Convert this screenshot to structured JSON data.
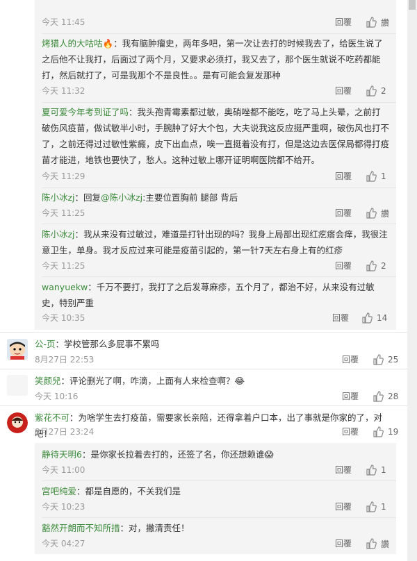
{
  "replies_block": [
    {
      "user": "",
      "text": "",
      "time": "今天 11:45",
      "reply_label": "回覆",
      "likes": "讚"
    },
    {
      "user": "烤猎人的大咕咕",
      "sep": "：",
      "text": "我有脑肿瘤史，两年多吧，第一次让去打的时候我去了，给医生说了之后他不让我打，后面过了两个月，又要求必须打，我又去了，那个医生就说不吃药都能打，然后就打了，可是我那个不是良性。。是有可能会复发那种",
      "time": "今天 11:32",
      "reply_label": "回覆",
      "likes": "2"
    },
    {
      "user": "夏可爱今年考到证了吗",
      "sep": "：",
      "text": "我头孢青霉素都过敏，奥硝唑都不能吃，吃了马上头晕，之前打破伤风疫苗，做试敏半小时，手腕肿了好大个包，大夫说我这反应挺严重啊，破伤风也打不了，之前还得过过敏性紫癜，皮下出血点，唉一直挺着没有打，但是这边去医保局都得打疫苗才能进，地铁也要快了，愁人。这种过敏上哪开证明啊医院都不给开。",
      "time": "今天 11:29",
      "reply_label": "回覆",
      "likes": "1"
    },
    {
      "user": "陈小冰zj",
      "sep": "：回复",
      "mention": "@陈小冰zj",
      "text": ":主要位置胸前 腿部 背后",
      "time": "今天 11:25",
      "reply_label": "回覆",
      "likes": "讚"
    },
    {
      "user": "陈小冰zj",
      "sep": "：",
      "text": "我从来没有过敏过，难道是打针出现的吗？我身上局部出现红疙瘩会痒，我很注意卫生，单身。我才反应过来可能是疫苗引起的，第一针7天左右身上有的红疹",
      "time": "今天 11:25",
      "reply_label": "回覆",
      "likes": "2"
    },
    {
      "user": "wanyuekw",
      "sep": "：",
      "text": "千万不要打，我打了之后发荨麻疹，五个月了，都治不好，从来没有过敏史，特别严重",
      "time": "今天 10:35",
      "reply_label": "回覆",
      "likes": "14"
    }
  ],
  "top_comments": [
    {
      "user": "公-页",
      "text": "学校管那么多屁事不累吗",
      "time": "8月27日 22:53",
      "reply_label": "回覆",
      "likes": "25",
      "avatar": "crayon-avatar"
    },
    {
      "user": "笑颜兒",
      "text": "评论删光了啊，咋滴，上面有人来检查啊？",
      "emoji": "😂",
      "time": "今天 10:16",
      "reply_label": "回覆",
      "likes": "28",
      "avatar": "blank-avatar"
    },
    {
      "user": "紫花不可",
      "text": "为啥学生去打疫苗，需要家长亲陪，还得拿着户口本，出了事就是你家的了，对吧！",
      "time": "8月27日 23:24",
      "reply_label": "回覆",
      "likes": "19",
      "avatar": "red-avatar"
    }
  ],
  "sub_replies": [
    {
      "user": "静待天明6",
      "sep": "：",
      "text": "是你家长拉着去打的，还签了名，你还想赖谁",
      "emoji": "😱",
      "time": "今天 11:00",
      "reply_label": "回覆",
      "likes": "1"
    },
    {
      "user": "宫吧纯爱",
      "sep": "：",
      "text": "都是自愿的，不关我们是",
      "time": "今天 10:23",
      "reply_label": "回覆",
      "likes": "1"
    },
    {
      "user": "豁然开朗而不知所措",
      "sep": "：",
      "text": "对，撇清责任！",
      "time": "今天 04:27",
      "reply_label": "回覆",
      "likes": "讚"
    }
  ],
  "colors": {
    "username": "#3b8a3b",
    "meta": "#999999",
    "reply_bg": "#f4f4f4"
  }
}
